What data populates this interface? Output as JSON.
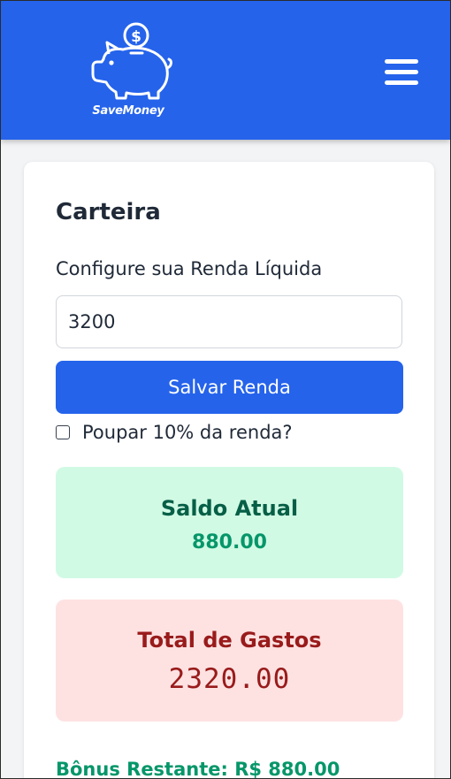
{
  "header": {
    "logo_text": "SaveMoney",
    "menu_icon": "hamburger-menu-icon",
    "background_color": "#2563eb"
  },
  "wallet": {
    "title": "Carteira",
    "income_label": "Configure sua Renda Líquida",
    "income_value": "3200",
    "save_button_label": "Salvar Renda",
    "save_ten_percent_label": "Poupar 10% da renda?",
    "save_ten_percent_checked": false
  },
  "balance": {
    "title": "Saldo Atual",
    "value": "880.00",
    "background_color": "#d1fae5",
    "text_color": "#065f46"
  },
  "expenses": {
    "title": "Total de Gastos",
    "value": "2320.00",
    "background_color": "#fee2e2",
    "text_color": "#991b1b"
  },
  "bonus": {
    "text": "Bônus Restante: R$ 880.00",
    "color": "#059669"
  }
}
